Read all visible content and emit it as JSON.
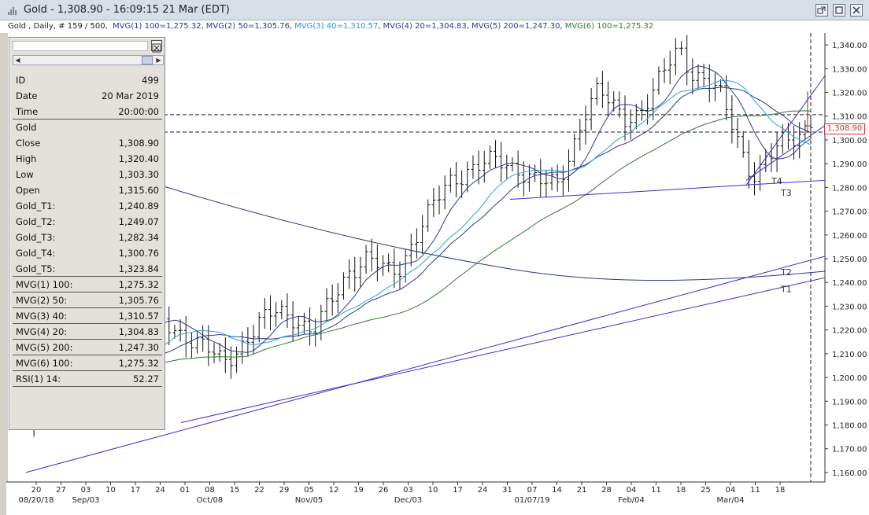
{
  "window": {
    "title": "Gold - 1,308.90 - 16:09:15  21 Mar (EDT)"
  },
  "legend": {
    "prefix": "Gold , Daily, # 159 / 500,",
    "items": [
      {
        "text": "MVG(1) 100=1,275.32",
        "color": "#2a3a8a"
      },
      {
        "text": "MVG(2) 50=1,305.76",
        "color": "#2a3a8a"
      },
      {
        "text": "MVG(3) 40=1,310.57",
        "color": "#2f8fd8"
      },
      {
        "text": "MVG(4) 20=1,304.83",
        "color": "#2a3a8a"
      },
      {
        "text": "MVG(5) 200=1,247.30",
        "color": "#2a3a8a"
      },
      {
        "text": "MVG(6) 100=1,275.32",
        "color": "#2f7a2f"
      }
    ]
  },
  "price_marker": "1,308.90",
  "info_panel": {
    "rows": [
      {
        "label": "ID",
        "value": "499",
        "sep": false
      },
      {
        "label": "Date",
        "value": "20 Mar 2019",
        "sep": false
      },
      {
        "label": "Time",
        "value": "20:00:00",
        "sep": true
      },
      {
        "label": "Gold",
        "value": "",
        "sep": false
      },
      {
        "label": "Close",
        "value": "1,308.90",
        "sep": false
      },
      {
        "label": "High",
        "value": "1,320.40",
        "sep": false
      },
      {
        "label": "Low",
        "value": "1,303.30",
        "sep": false
      },
      {
        "label": "Open",
        "value": "1,315.60",
        "sep": false
      },
      {
        "label": "Gold_T1:",
        "value": "1,240.89",
        "sep": false
      },
      {
        "label": "Gold_T2:",
        "value": "1,249.07",
        "sep": false
      },
      {
        "label": "Gold_T3:",
        "value": "1,282.34",
        "sep": false
      },
      {
        "label": "Gold_T4:",
        "value": "1,300.76",
        "sep": false
      },
      {
        "label": "Gold_T5:",
        "value": "1,323.84",
        "sep": true
      },
      {
        "label": "MVG(1) 100:",
        "value": "1,275.32",
        "sep": true
      },
      {
        "label": "MVG(2) 50:",
        "value": "1,305.76",
        "sep": true
      },
      {
        "label": "MVG(3) 40:",
        "value": "1,310.57",
        "sep": true
      },
      {
        "label": "MVG(4) 20:",
        "value": "1,304.83",
        "sep": true
      },
      {
        "label": "MVG(5) 200:",
        "value": "1,247.30",
        "sep": true
      },
      {
        "label": "MVG(6) 100:",
        "value": "1,275.32",
        "sep": true
      },
      {
        "label": "RSI(1) 14:",
        "value": "52.27",
        "sep": true
      }
    ]
  },
  "chart_data": {
    "type": "ohlc",
    "y_ticks": [
      "1,340.00",
      "1,330.00",
      "1,320.00",
      "1,310.00",
      "1,300.00",
      "1,290.00",
      "1,280.00",
      "1,270.00",
      "1,260.00",
      "1,250.00",
      "1,240.00",
      "1,230.00",
      "1,220.00",
      "1,210.00",
      "1,200.00",
      "1,190.00",
      "1,180.00",
      "1,170.00",
      "1,160.00"
    ],
    "y_tick_values": [
      1340,
      1330,
      1320,
      1310,
      1300,
      1290,
      1280,
      1270,
      1260,
      1250,
      1240,
      1230,
      1220,
      1210,
      1200,
      1190,
      1180,
      1170,
      1160
    ],
    "ylim": [
      1156,
      1345
    ],
    "x_day_ticks": [
      "20",
      "27",
      "03",
      "10",
      "17",
      "24",
      "01",
      "08",
      "15",
      "22",
      "29",
      "05",
      "12",
      "19",
      "26",
      "03",
      "10",
      "17",
      "24",
      "31",
      "07",
      "14",
      "21",
      "28",
      "04",
      "11",
      "18",
      "25",
      "04",
      "11",
      "18"
    ],
    "x_month_labels": [
      {
        "text": "08/20/18",
        "at_tick": 0
      },
      {
        "text": "Sep/03",
        "at_tick": 2
      },
      {
        "text": "Oct/08",
        "at_tick": 7
      },
      {
        "text": "Nov/05",
        "at_tick": 11
      },
      {
        "text": "Dec/03",
        "at_tick": 15
      },
      {
        "text": "01/07/19",
        "at_tick": 20
      },
      {
        "text": "Feb/04",
        "at_tick": 24
      },
      {
        "text": "Mar/04",
        "at_tick": 28
      }
    ],
    "trendline_labels": [
      "T4",
      "T3",
      "T2",
      "T1"
    ],
    "horizontal_levels": [
      1310.6,
      1303.3
    ],
    "colors": {
      "bars": "#111111",
      "trend": "#3a2fd0",
      "ma_dark": "#2a3a8a",
      "ma_light": "#2fa0e0",
      "ma_green": "#2f7a2f"
    }
  }
}
